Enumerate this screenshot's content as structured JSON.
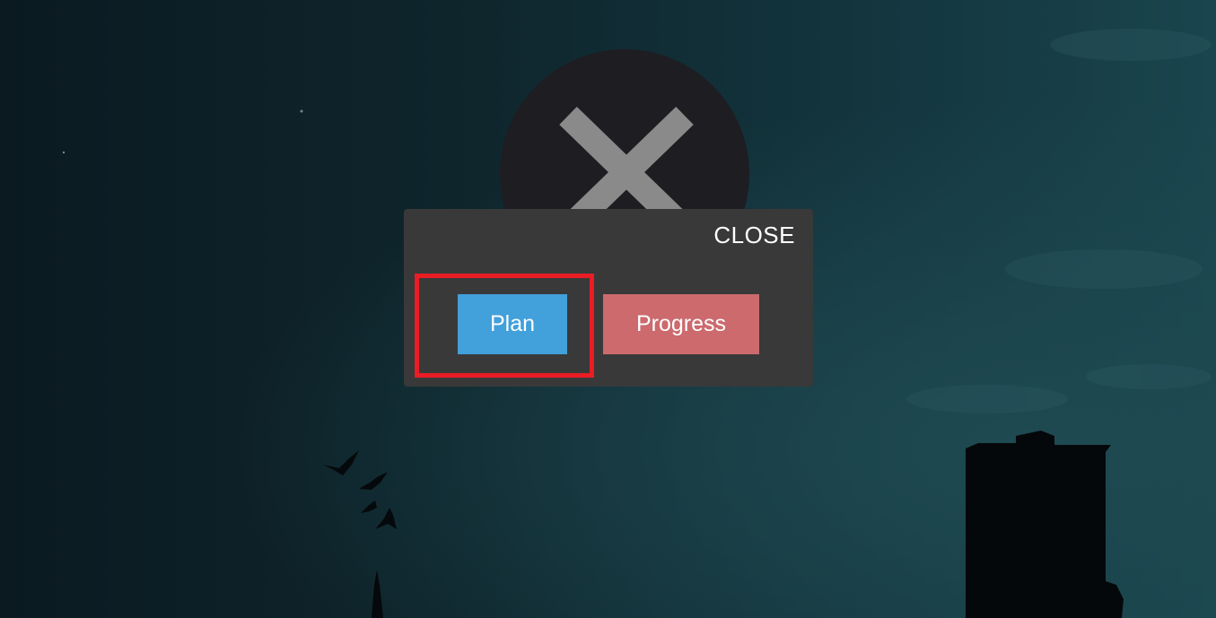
{
  "dialog": {
    "close_label": "CLOSE",
    "buttons": {
      "plan_label": "Plan",
      "progress_label": "Progress"
    }
  },
  "colors": {
    "plan_button": "#42a0da",
    "progress_button": "#cc6a6e",
    "highlight": "#ea1c24",
    "dialog_background": "#393939",
    "close_circle": "#1e1d21",
    "close_x": "#8a8a8a"
  },
  "icons": {
    "large_close": "close-x-icon"
  }
}
